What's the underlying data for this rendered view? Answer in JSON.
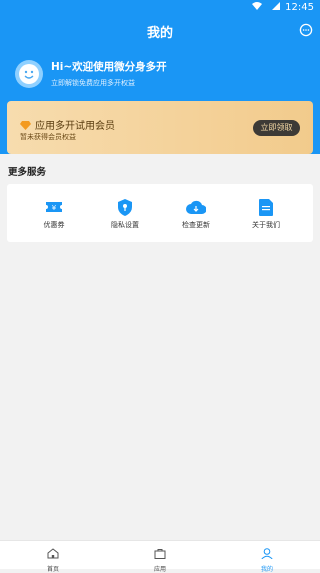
{
  "status_bar": {
    "time": "12:45",
    "icons": [
      "wifi-icon",
      "signal-icon"
    ]
  },
  "nav": {
    "title": "我的",
    "message_icon": "chat-bubble-icon"
  },
  "profile": {
    "greeting": "Hi~欢迎使用微分身多开",
    "subtitle": "立即解锁免费应用多开权益"
  },
  "vip": {
    "title": "应用多开试用会员",
    "subtitle": "暂未获得会员权益",
    "button_label": "立即领取",
    "icon": "diamond-icon"
  },
  "services": {
    "title": "更多服务",
    "items": [
      {
        "label": "优惠券",
        "icon": "coupon-icon"
      },
      {
        "label": "隐私设置",
        "icon": "shield-icon"
      },
      {
        "label": "检查更新",
        "icon": "cloud-download-icon"
      },
      {
        "label": "关于我们",
        "icon": "document-icon"
      }
    ]
  },
  "tabbar": {
    "items": [
      {
        "label": "首页",
        "icon": "home-icon",
        "active": false
      },
      {
        "label": "应用",
        "icon": "bag-icon",
        "active": false
      },
      {
        "label": "我的",
        "icon": "user-icon",
        "active": true
      }
    ]
  },
  "colors": {
    "primary": "#1a96f5",
    "vip_gold": "#f2cb8c",
    "vip_button": "#3d3a36",
    "background": "#f2f2f2"
  }
}
